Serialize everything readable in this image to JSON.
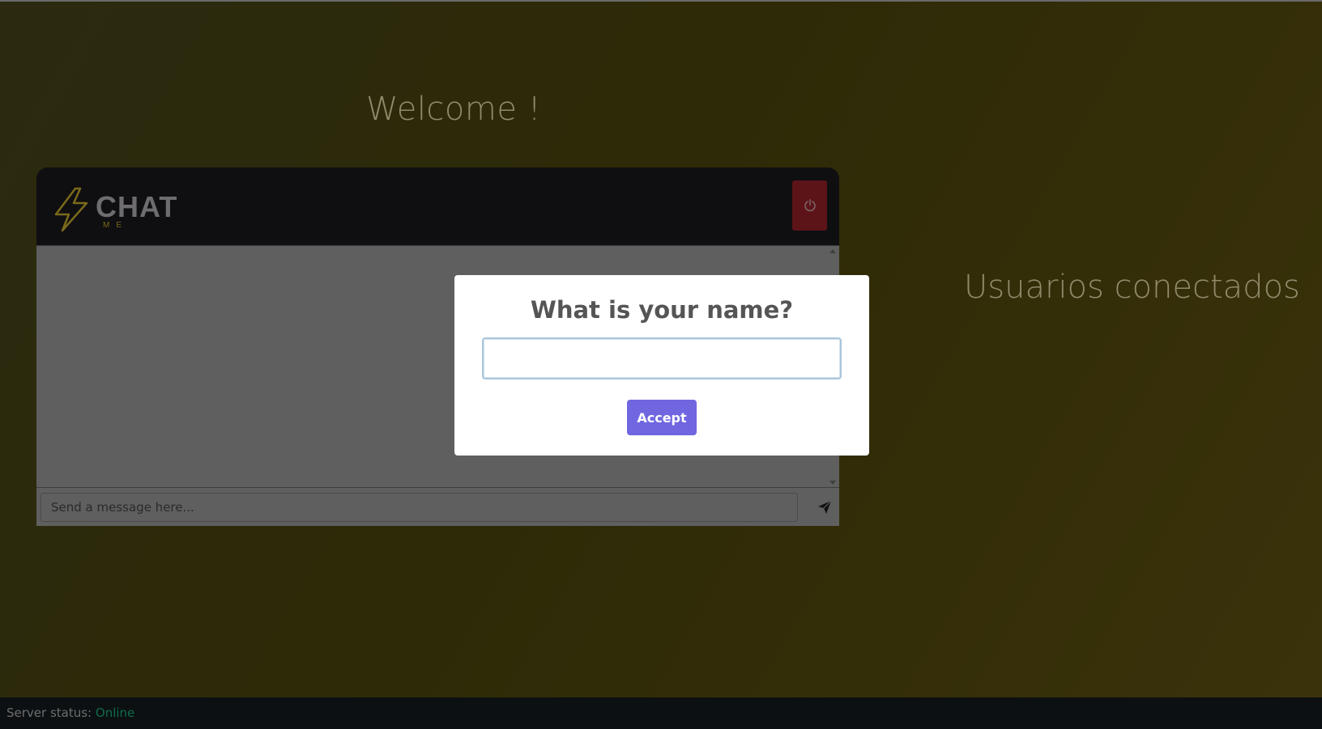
{
  "page": {
    "welcome": "Welcome !",
    "users_title": "Usuarios conectados"
  },
  "chat": {
    "logo_text": "CHAT",
    "logo_sub": "ME",
    "logo_icon": "lightning-bolt-icon",
    "power_icon": "power-icon",
    "send_icon": "paper-plane-icon",
    "input_placeholder": "Send a message here...",
    "input_value": ""
  },
  "modal": {
    "title": "What is your name?",
    "name_value": "",
    "accept_label": "Accept"
  },
  "status": {
    "label": "Server status:",
    "value": "Online"
  },
  "colors": {
    "accept_button": "#7066e0",
    "power_button": "#5c1419",
    "status_online": "#0f6b4b",
    "logo_accent": "#7a6a1a"
  }
}
